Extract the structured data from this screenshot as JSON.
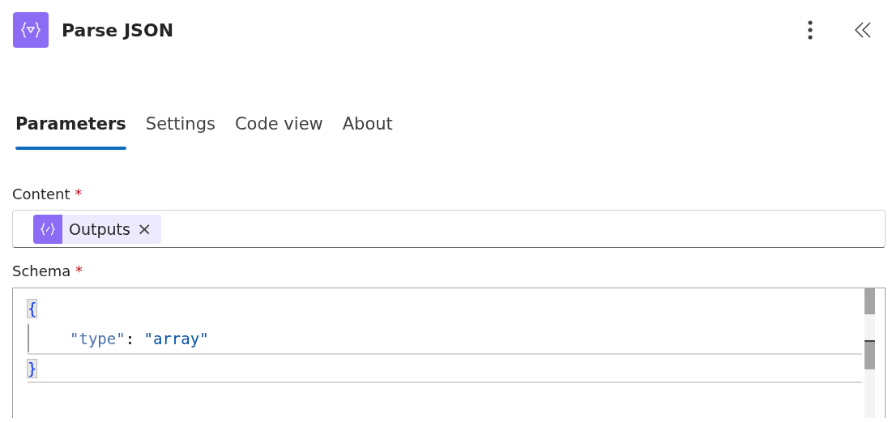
{
  "header": {
    "title": "Parse JSON"
  },
  "tabs": [
    {
      "label": "Parameters",
      "selected": true
    },
    {
      "label": "Settings",
      "selected": false
    },
    {
      "label": "Code view",
      "selected": false
    },
    {
      "label": "About",
      "selected": false
    }
  ],
  "content": {
    "label": "Content",
    "required": "*",
    "tokens": [
      {
        "label": "Outputs",
        "remove": "×"
      }
    ]
  },
  "schema": {
    "label": "Schema",
    "required": "*",
    "lines": [
      {
        "indented": false,
        "current": false,
        "tokens": [
          {
            "kind": "bracket",
            "text": "{",
            "matched": true
          }
        ]
      },
      {
        "indented": true,
        "current": false,
        "tokens": [
          {
            "kind": "key",
            "text": "\"type\"",
            "matched": false
          },
          {
            "kind": "punct",
            "text": ": ",
            "matched": false
          },
          {
            "kind": "string",
            "text": "\"array\"",
            "matched": false
          }
        ]
      },
      {
        "indented": false,
        "current": true,
        "tokens": [
          {
            "kind": "bracket",
            "text": "}",
            "matched": true
          }
        ]
      }
    ]
  }
}
